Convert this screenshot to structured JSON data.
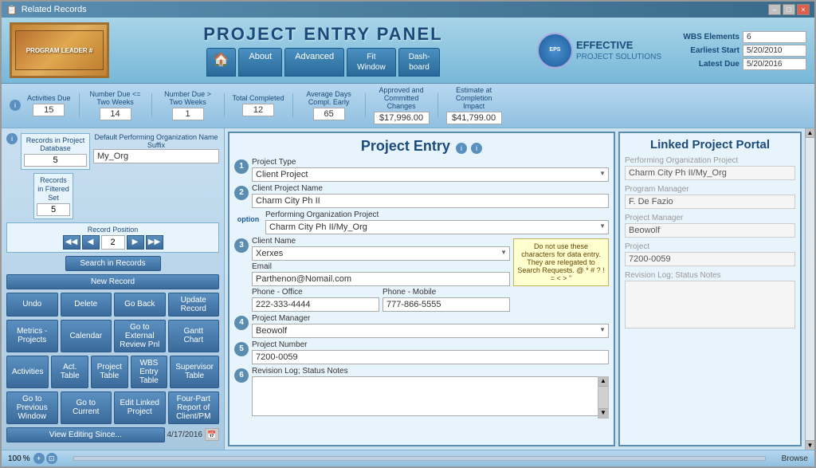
{
  "window": {
    "title": "Related Records",
    "controls": [
      "–",
      "□",
      "×"
    ]
  },
  "header": {
    "title": "PROJECT ENTRY PANEL",
    "nav_tabs": [
      {
        "id": "home",
        "label": "🏠",
        "type": "icon"
      },
      {
        "id": "about",
        "label": "About"
      },
      {
        "id": "advanced",
        "label": "Advanced"
      },
      {
        "id": "fit_window",
        "label": "Fit Window"
      },
      {
        "id": "dash_board",
        "label": "Dash-board"
      }
    ],
    "logo_text": "EFFECTIVE",
    "logo_sub": "PROJECT SOLUTIONS",
    "wbs_label": "WBS Elements",
    "wbs_value": "6",
    "earliest_start_label": "Earliest Start",
    "earliest_start_value": "5/20/2010",
    "latest_due_label": "Latest Due",
    "latest_due_value": "5/20/2016"
  },
  "program_leader": {
    "label": "PROGRAM LEADER #",
    "number": ""
  },
  "stats": [
    {
      "label": "Activities Due",
      "value": "15"
    },
    {
      "label": "Number Due <= Two Weeks",
      "value": "14"
    },
    {
      "label": "Number Due > Two Weeks",
      "value": "1"
    },
    {
      "label": "Total Completed",
      "value": "12"
    },
    {
      "label": "Average Days Compl. Early",
      "value": "65"
    },
    {
      "label": "Approved and Committed Changes",
      "value": "$17,996.00"
    },
    {
      "label": "Estimate at Completion Impact",
      "value": "$41,799.00"
    }
  ],
  "sidebar": {
    "records_in_db_label": "Records in Project Database",
    "records_in_db_value": "5",
    "records_in_set_label": "Records in Filtered Set",
    "records_in_set_value": "5",
    "default_org_label": "Default Performing Organization Name Suffix",
    "default_org_value": "My_Org",
    "record_position_label": "Record Position",
    "record_position_value": "2",
    "search_label": "Search in Records",
    "new_record_label": "New Record",
    "undo_label": "Undo",
    "delete_label": "Delete",
    "go_back_label": "Go Back",
    "update_label": "Update Record",
    "metrics_label": "Metrics - Projects",
    "calendar_label": "Calendar",
    "external_review_label": "Go to External Review Pnl",
    "gantt_label": "Gantt Chart",
    "activities_label": "Activities",
    "act_table_label": "Act. Table",
    "project_table_label": "Project Table",
    "wbs_entry_label": "WBS Entry Table",
    "supervisor_label": "Supervisor Table",
    "go_prev_label": "Go to Previous Window",
    "go_current_label": "Go to Current",
    "edit_linked_label": "Edit Linked Project",
    "four_part_label": "Four-Part Report of Client/PM",
    "view_editing_label": "View Editing Since...",
    "date_value": "4/17/2016"
  },
  "project_entry": {
    "title": "Project Entry",
    "fields": {
      "project_type_label": "Project Type",
      "project_type_value": "Client Project",
      "client_name_label": "Client Project Name",
      "client_name_value": "Charm City Ph II",
      "performing_org_label": "Performing Organization Project",
      "performing_org_value": "Charm City Ph II/My_Org",
      "client_label": "Client Name",
      "client_value": "Xerxes",
      "email_label": "Email",
      "email_value": "Parthenon@Nomail.com",
      "phone_office_label": "Phone - Office",
      "phone_office_value": "222-333-4444",
      "phone_mobile_label": "Phone - Mobile",
      "phone_mobile_value": "777-866-5555",
      "project_manager_label": "Project Manager",
      "project_manager_value": "Beowolf",
      "project_number_label": "Project Number",
      "project_number_value": "7200-0059",
      "revision_log_label": "Revision Log; Status Notes",
      "revision_log_value": ""
    },
    "note": "Do not use these characters for data entry. They are relegated to Search Requests. @ * # ? ! = < > \"",
    "option_label": "option"
  },
  "linked_portal": {
    "title": "Linked Project Portal",
    "performing_org_label": "Performing Organization Project",
    "performing_org_value": "Charm City Ph II/My_Org",
    "program_manager_label": "Program Manager",
    "program_manager_value": "F. De Fazio",
    "project_manager_label": "Project Manager",
    "project_manager_value": "Beowolf",
    "project_label": "Project",
    "project_value": "7200-0059",
    "revision_log_label": "Revision Log; Status Notes",
    "revision_log_value": ""
  },
  "bottom": {
    "zoom": "100",
    "zoom_icon": "⊕",
    "status": "Browse"
  }
}
